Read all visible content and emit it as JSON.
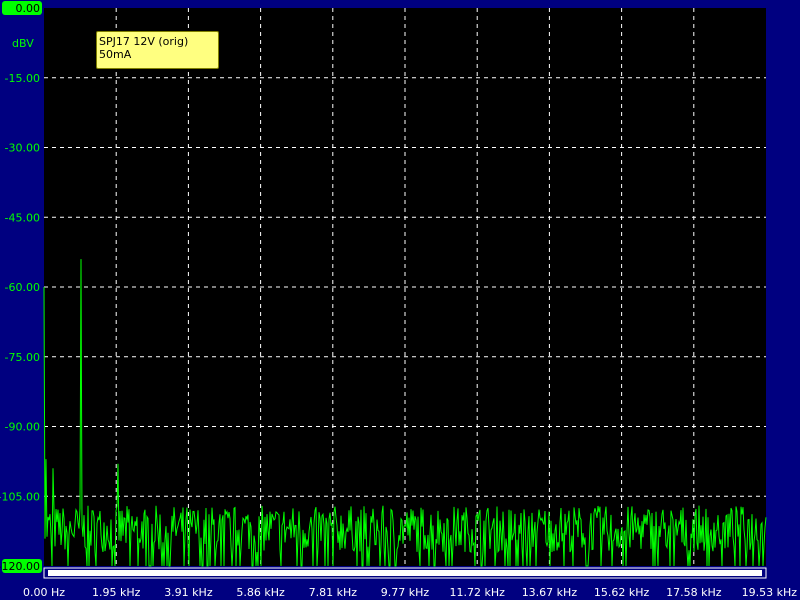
{
  "chart_data": {
    "type": "line",
    "ylabel": "dBV",
    "y_ticks": [
      "0.00",
      "-15.00",
      "-30.00",
      "-45.00",
      "-60.00",
      "-75.00",
      "-90.00",
      "-105.00",
      "-120.00"
    ],
    "x_ticks": [
      "0.00 Hz",
      "1.95 kHz",
      "3.91 kHz",
      "5.86 kHz",
      "7.81 kHz",
      "9.77 kHz",
      "11.72 kHz",
      "13.67 kHz",
      "15.62 kHz",
      "17.58 kHz",
      "19.53 kHz"
    ],
    "ylim": [
      -120,
      0
    ],
    "xlim": [
      0,
      19.53
    ],
    "x_unit": "kHz",
    "grid": true,
    "legend_position": "top-left",
    "series": [
      {
        "name": "SPJ17 12V (orig) 50mA",
        "color": "#00ff00",
        "noise_floor_dbv": -112,
        "peaks": [
          {
            "x": 0.0,
            "y": -60
          },
          {
            "x": 0.05,
            "y": -97
          },
          {
            "x": 0.25,
            "y": -99
          },
          {
            "x": 1.0,
            "y": -54
          },
          {
            "x": 2.0,
            "y": -98
          }
        ]
      }
    ]
  },
  "colors": {
    "background": "#000080",
    "plot_area": "#000000",
    "trace": "#00ff00",
    "grid": "#ffffff",
    "legend_bg": "#ffff80"
  }
}
